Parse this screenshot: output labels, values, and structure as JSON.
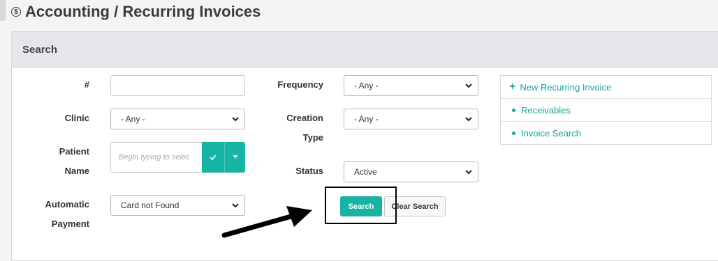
{
  "header": {
    "title": "Accounting / Recurring Invoices",
    "icon": "dollar-circle-icon"
  },
  "panel": {
    "title": "Search"
  },
  "form": {
    "number_label": "#",
    "number_value": "",
    "clinic_label": "Clinic",
    "clinic_value": "- Any -",
    "patient_label_1": "Patient",
    "patient_label_2": "Name",
    "patient_placeholder": "Begin typing to selec",
    "automatic_label_1": "Automatic",
    "automatic_label_2": "Payment",
    "automatic_value": "Card not Found",
    "frequency_label": "Frequency",
    "frequency_value": "- Any -",
    "creation_label_1": "Creation",
    "creation_label_2": "Type",
    "creation_value": "- Any -",
    "status_label": "Status",
    "status_value": "Active",
    "search_button": "Search",
    "clear_button": "Clear Search"
  },
  "links": [
    {
      "label": "New Recurring Invoice",
      "icon": "plus-icon"
    },
    {
      "label": "Receivables",
      "icon": "bullet-icon"
    },
    {
      "label": "Invoice Search",
      "icon": "bullet-icon"
    }
  ],
  "colors": {
    "accent": "#17b3a3",
    "link": "#17a698",
    "header_bg": "#e4e6e9"
  }
}
